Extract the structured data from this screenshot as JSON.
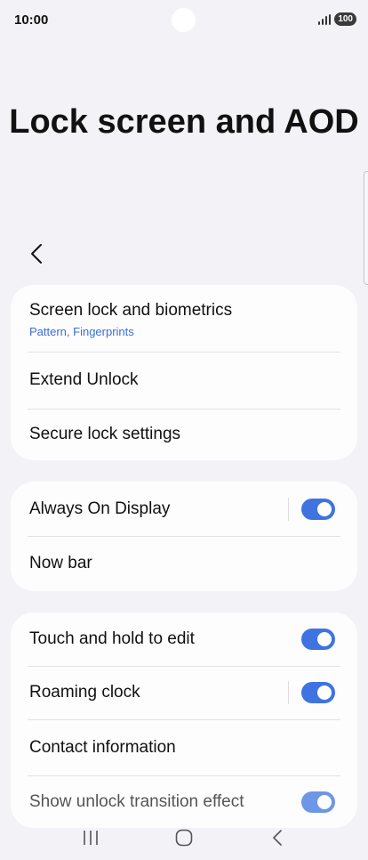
{
  "status_bar": {
    "time": "10:00",
    "battery": "100",
    "icons": [
      "signal-icon",
      "battery-icon"
    ]
  },
  "header": {
    "title": "Lock screen and AOD",
    "back_icon": "back-arrow-icon"
  },
  "cards": [
    {
      "rows": [
        {
          "label": "Screen lock and biometrics",
          "sublabel": "Pattern, Fingerprints"
        },
        {
          "label": "Extend Unlock"
        },
        {
          "label": "Secure lock settings"
        }
      ]
    },
    {
      "rows": [
        {
          "label": "Always On Display",
          "toggle": true
        },
        {
          "label": "Now bar"
        }
      ]
    },
    {
      "rows": [
        {
          "label": "Touch and hold to edit",
          "toggle": true
        },
        {
          "label": "Roaming clock",
          "toggle": true
        },
        {
          "label": "Contact information"
        },
        {
          "label": "Show unlock transition effect",
          "toggle": true
        }
      ]
    }
  ],
  "nav_bar": {
    "icons": [
      "recents-icon",
      "home-icon",
      "back-icon"
    ]
  },
  "colors": {
    "accent": "#3f74e0",
    "sublabel": "#3b6dd6",
    "background": "#f3f2f7",
    "card": "#fdfdfe"
  }
}
